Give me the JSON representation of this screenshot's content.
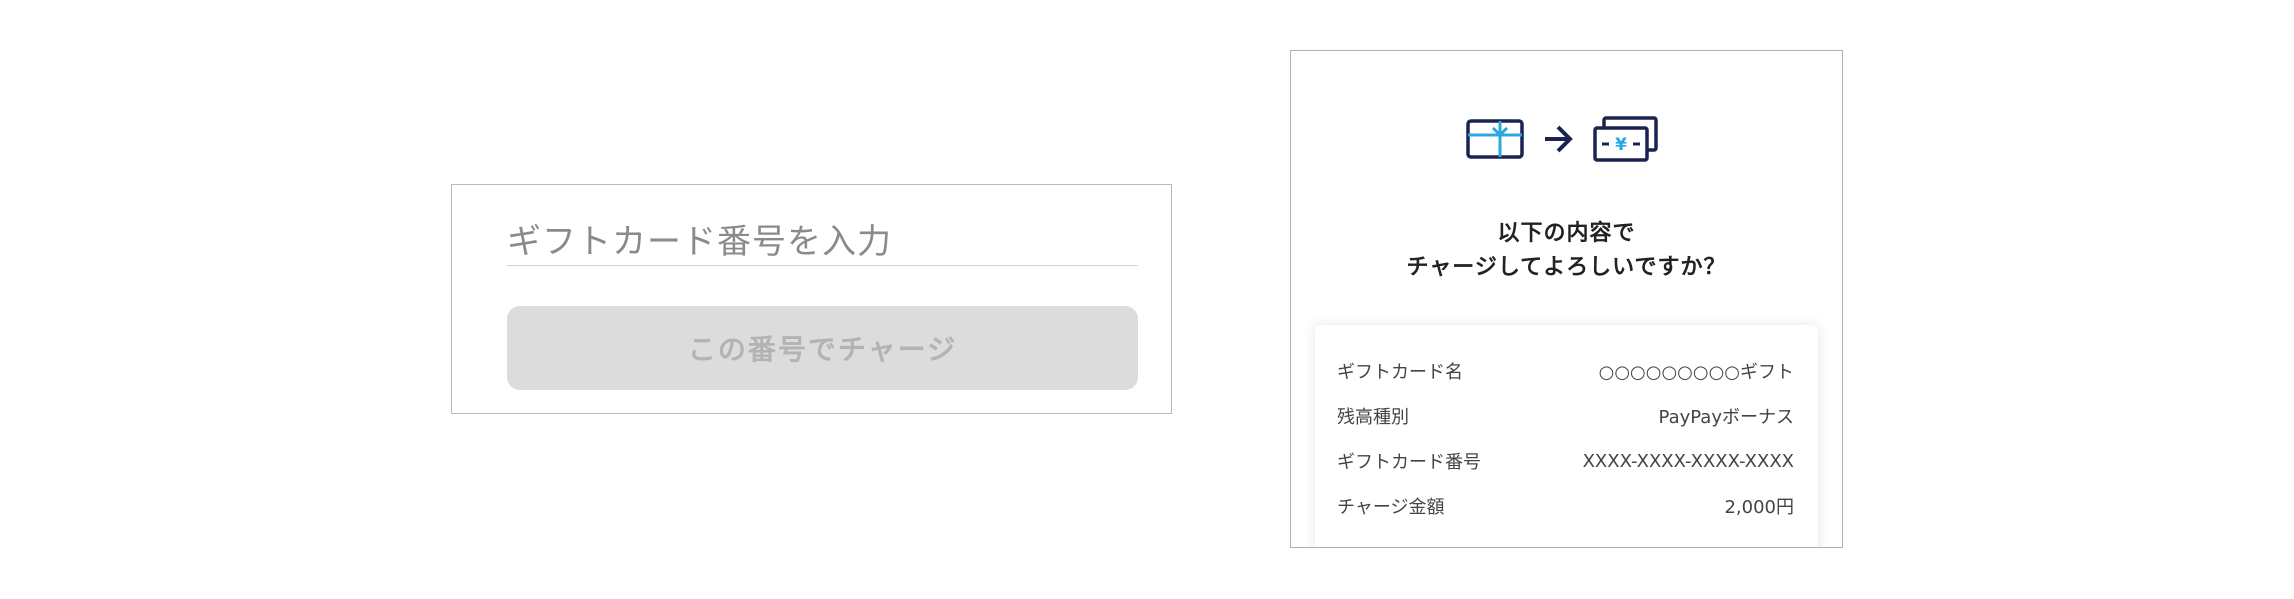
{
  "gift_input": {
    "placeholder": "ギフトカード番号を入力",
    "charge_button_label": "この番号でチャージ"
  },
  "confirm": {
    "title_line1": "以下の内容で",
    "title_line2": "チャージしてよろしいですか？",
    "details": [
      {
        "label": "ギフトカード名",
        "value": "○○○○○○○○○ギフト"
      },
      {
        "label": "残高種別",
        "value": "PayPayボーナス"
      },
      {
        "label": "ギフトカード番号",
        "value": "XXXX-XXXX-XXXX-XXXX"
      },
      {
        "label": "チャージ金額",
        "value": "2,000円"
      }
    ],
    "icons": {
      "gift_card": "gift-card-icon",
      "arrow": "arrow-right-icon",
      "money": "yen-bills-icon",
      "yen_symbol": "¥"
    }
  },
  "colors": {
    "navy": "#1b2350",
    "ribbon_blue": "#29a8df",
    "disabled_button": "#dcdcdc",
    "disabled_text": "#b3b3b3"
  }
}
